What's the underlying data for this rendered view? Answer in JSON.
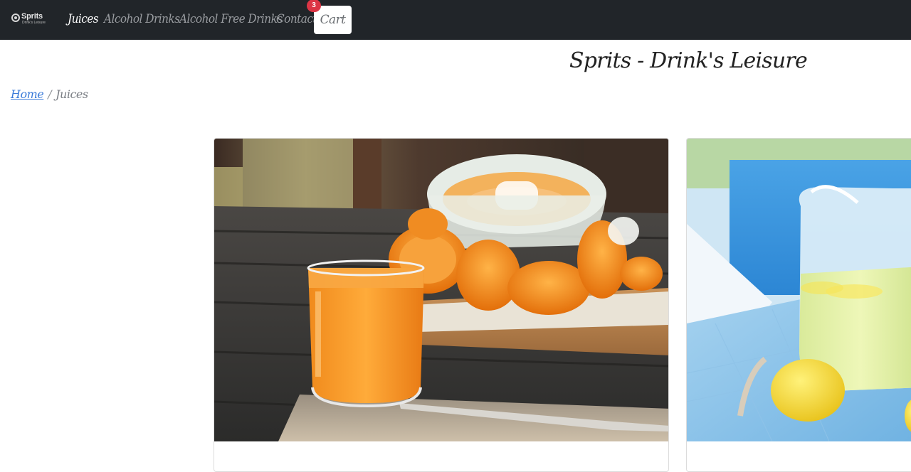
{
  "brand": {
    "name": "Sprits",
    "tagline": "Drink's Leisure"
  },
  "nav": {
    "items": [
      {
        "label": "Juices",
        "active": true
      },
      {
        "label": "Alcohol Drinks",
        "active": false
      },
      {
        "label": "Alcohol Free Drinks",
        "active": false
      },
      {
        "label": "Contact",
        "active": false
      }
    ],
    "cart": {
      "label": "Cart",
      "count": "3"
    }
  },
  "page": {
    "title": "Sprits - Drink's Leisure"
  },
  "breadcrumb": {
    "home": "Home",
    "separator": "/",
    "current": "Juices"
  },
  "products": [
    {
      "image": "orange-juice-photo",
      "title": ""
    },
    {
      "image": "lemonade-photo",
      "title": ""
    }
  ],
  "colors": {
    "navbar_bg": "#212529",
    "badge": "#dc3545",
    "link": "#3b7bd9"
  }
}
